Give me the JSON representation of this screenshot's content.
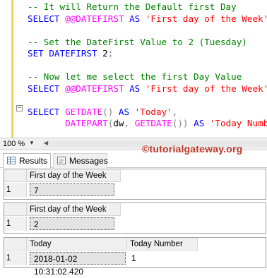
{
  "editor": {
    "lines": [
      [
        {
          "t": "-- It will Return the Default first Day",
          "c": "cm"
        }
      ],
      [
        {
          "t": "SELECT ",
          "c": "kw"
        },
        {
          "t": "@@DATEFIRST",
          "c": "fn"
        },
        {
          "t": " AS ",
          "c": "kw"
        },
        {
          "t": "'First day of the Week'",
          "c": "st"
        }
      ],
      [],
      [
        {
          "t": "-- Set the DateFirst Value to 2 (Tuesday)",
          "c": "cm"
        }
      ],
      [
        {
          "t": "SET DATEFIRST ",
          "c": "kw"
        },
        {
          "t": "2",
          "c": "id"
        },
        {
          "t": ";",
          "c": "op"
        }
      ],
      [],
      [
        {
          "t": "-- Now let me select the first Day Value",
          "c": "cm"
        }
      ],
      [
        {
          "t": "SELECT ",
          "c": "kw"
        },
        {
          "t": "@@DATEFIRST",
          "c": "fn"
        },
        {
          "t": " AS ",
          "c": "kw"
        },
        {
          "t": "'First day of the Week'",
          "c": "st"
        }
      ],
      [],
      [
        {
          "t": "SELECT ",
          "c": "kw"
        },
        {
          "t": "GETDATE",
          "c": "fn"
        },
        {
          "t": "() ",
          "c": "op"
        },
        {
          "t": "AS ",
          "c": "kw"
        },
        {
          "t": "'Today'",
          "c": "st"
        },
        {
          "t": ",",
          "c": "op"
        }
      ],
      [
        {
          "t": "       ",
          "c": "id"
        },
        {
          "t": "DATEPART",
          "c": "fn"
        },
        {
          "t": "(",
          "c": "op"
        },
        {
          "t": "dw",
          "c": "id"
        },
        {
          "t": ", ",
          "c": "op"
        },
        {
          "t": "GETDATE",
          "c": "fn"
        },
        {
          "t": "()) ",
          "c": "op"
        },
        {
          "t": "AS ",
          "c": "kw"
        },
        {
          "t": "'Today Number'",
          "c": "st"
        }
      ]
    ]
  },
  "zoom": {
    "value": "100 %"
  },
  "tabs": {
    "results": "Results",
    "messages": "Messages"
  },
  "watermark": "©tutorialgateway.org",
  "grids": [
    {
      "columns": [
        "First day of the Week"
      ],
      "rows": [
        {
          "num": "1",
          "cells": [
            "7"
          ]
        }
      ]
    },
    {
      "columns": [
        "First day of the Week"
      ],
      "rows": [
        {
          "num": "1",
          "cells": [
            "2"
          ]
        }
      ]
    },
    {
      "columns": [
        "Today",
        "Today Number"
      ],
      "rows": [
        {
          "num": "1",
          "cells": [
            "2018-01-02 10:31:02.420",
            "1"
          ]
        }
      ]
    }
  ],
  "colors": {
    "comment": "#008000",
    "keyword": "#0000ff",
    "function": "#ff00ff",
    "string": "#ff0000",
    "watermark": "#c0392b"
  }
}
